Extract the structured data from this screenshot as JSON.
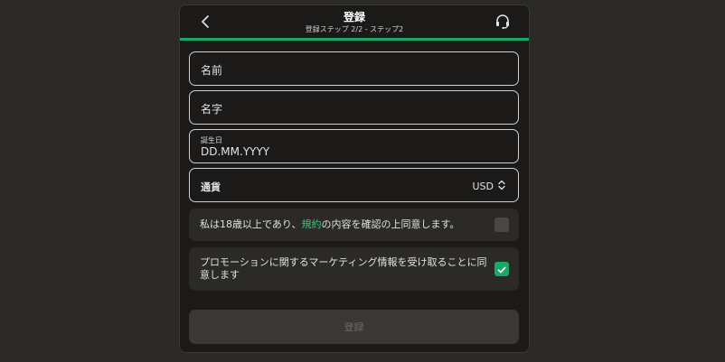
{
  "header": {
    "title": "登録",
    "subtitle": "登録ステップ 2/2 - ステップ2",
    "back_icon": "chevron-left-icon",
    "support_icon": "headset-icon",
    "accent_color": "#1aa866"
  },
  "form": {
    "first_name_label": "名前",
    "last_name_label": "名字",
    "dob_label": "誕生日",
    "dob_placeholder": "DD.MM.YYYY",
    "currency_label": "通貨",
    "currency_value": "USD"
  },
  "consents": {
    "age_prefix": "私は18歳以上であり、",
    "age_link": "規約",
    "age_suffix": "の内容を確認の上同意します。",
    "age_checked": false,
    "promo_line1": "プロモーションに関するマーケティング情報を受け取ることに同",
    "promo_line2": "意します",
    "promo_checked": true
  },
  "submit_label": "登録"
}
